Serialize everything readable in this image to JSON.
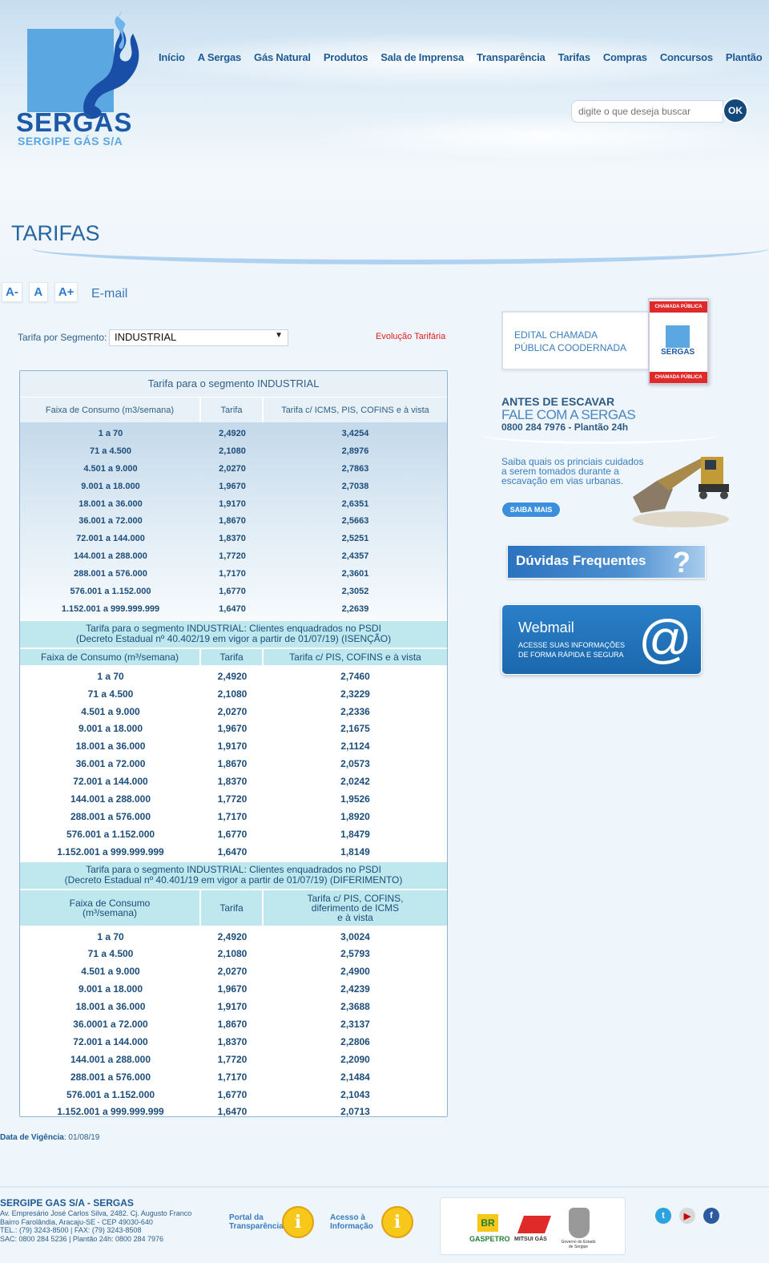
{
  "brand": {
    "name": "SERGAS",
    "subtitle": "SERGIPE GÁS S/A"
  },
  "nav": [
    "Início",
    "A Sergas",
    "Gás Natural",
    "Produtos",
    "Sala de Imprensa",
    "Transparência",
    "Tarifas",
    "Compras",
    "Concursos",
    "Plantão"
  ],
  "search": {
    "placeholder": "digite o que deseja buscar",
    "button_label": "OK"
  },
  "page_title": "TARIFAS",
  "font_controls": [
    "A-",
    "A",
    "A+"
  ],
  "email_link": "E-mail",
  "segment": {
    "label": "Tarifa por Segmento:",
    "selected": "INDUSTRIAL"
  },
  "evolution_link": "Evolução Tarifária",
  "table1": {
    "caption": "Tarifa para o segmento INDUSTRIAL",
    "headers": [
      "Faixa de Consumo (m3/semana)",
      "Tarifa",
      "Tarifa c/ ICMS, PIS, COFINS e à vista"
    ],
    "rows": [
      [
        "1 a 70",
        "2,4920",
        "3,4254"
      ],
      [
        "71 a 4.500",
        "2,1080",
        "2,8976"
      ],
      [
        "4.501 a 9.000",
        "2,0270",
        "2,7863"
      ],
      [
        "9.001 a 18.000",
        "1,9670",
        "2,7038"
      ],
      [
        "18.001 a 36.000",
        "1,9170",
        "2,6351"
      ],
      [
        "36.001 a 72.000",
        "1,8670",
        "2,5663"
      ],
      [
        "72.001 a 144.000",
        "1,8370",
        "2,5251"
      ],
      [
        "144.001 a 288.000",
        "1,7720",
        "2,4357"
      ],
      [
        "288.001 a 576.000",
        "1,7170",
        "2,3601"
      ],
      [
        "576.001 a 1.152.000",
        "1,6770",
        "2,3052"
      ],
      [
        "1.152.001 a 999.999.999",
        "1,6470",
        "2,2639"
      ]
    ]
  },
  "table2": {
    "caption_line1": "Tarifa para o segmento INDUSTRIAL: Clientes enquadrados no PSDI",
    "caption_line2": "(Decreto Estadual nº 40.402/19 em vigor a partir de 01/07/19)  (ISENÇÃO)",
    "headers": [
      "Faixa de Consumo (m³/semana)",
      "Tarifa",
      "Tarifa c/ PIS, COFINS e à vista"
    ],
    "rows": [
      [
        "1 a 70",
        "2,4920",
        "2,7460"
      ],
      [
        "71 a 4.500",
        "2,1080",
        "2,3229"
      ],
      [
        "4.501 a 9.000",
        "2,0270",
        "2,2336"
      ],
      [
        "9.001 a 18.000",
        "1,9670",
        "2,1675"
      ],
      [
        "18.001 a 36.000",
        "1,9170",
        "2,1124"
      ],
      [
        "36.001 a 72.000",
        "1,8670",
        "2,0573"
      ],
      [
        "72.001 a 144.000",
        "1,8370",
        "2,0242"
      ],
      [
        "144.001 a 288.000",
        "1,7720",
        "1,9526"
      ],
      [
        "288.001 a 576.000",
        "1,7170",
        "1,8920"
      ],
      [
        "576.001 a 1.152.000",
        "1,6770",
        "1,8479"
      ],
      [
        "1.152.001 a 999.999.999",
        "1,6470",
        "1,8149"
      ]
    ]
  },
  "table3": {
    "caption_line1": "Tarifa para o segmento INDUSTRIAL: Clientes enquadrados no PSDI",
    "caption_line2": "(Decreto Estadual nº 40.401/19 em vigor a partir de 01/07/19)  (DIFERIMENTO)",
    "header1_line1": "Faixa de Consumo",
    "header1_line2": "(m³/semana)",
    "header2": "Tarifa",
    "header3_line1": "Tarifa c/ PIS, COFINS,",
    "header3_line2": "diferimento de ICMS",
    "header3_line3": "e à vista",
    "rows": [
      [
        "1 a 70",
        "2,4920",
        "3,0024"
      ],
      [
        "71 a 4.500",
        "2,1080",
        "2,5793"
      ],
      [
        "4.501 a 9.000",
        "2,0270",
        "2,4900"
      ],
      [
        "9.001 a 18.000",
        "1,9670",
        "2,4239"
      ],
      [
        "18.001 a 36.000",
        "1,9170",
        "2,3688"
      ],
      [
        "36.0001 a 72.000",
        "1,8670",
        "2,3137"
      ],
      [
        "72.001 a 144.000",
        "1,8370",
        "2,2806"
      ],
      [
        "144.001 a 288.000",
        "1,7720",
        "2,2090"
      ],
      [
        "288.001 a 576.000",
        "1,7170",
        "2,1484"
      ],
      [
        "576.001 a 1.152.000",
        "1,6770",
        "2,1043"
      ],
      [
        "1.152.001 a 999.999.999",
        "1,6470",
        "2,0713"
      ]
    ]
  },
  "vigencia": {
    "label": "Data de Vigência",
    "value": ": 01/08/19"
  },
  "sidebar": {
    "chamada": {
      "text": "EDITAL CHAMADA PÚBLICA COODERNADA",
      "badge_top": "CHAMADA PÚBLICA",
      "badge_bottom": "CHAMADA PÚBLICA",
      "badge_brand": "SERGAS"
    },
    "escavar": {
      "line1": "ANTES DE ESCAVAR",
      "line2": "FALE COM A SERGAS",
      "line3": "0800 284 7976 - Plantão 24h",
      "body": "Saiba quais os princiais cuidados a serem tomados durante a escavação em vias urbanas.",
      "button": "SAIBA MAIS"
    },
    "duvidas": {
      "title": "Dúvidas Frequentes",
      "icon": "?"
    },
    "webmail": {
      "title": "Webmail",
      "line1": "ACESSE SUAS INFORMAÇÕES",
      "line2": "DE FORMA RÁPIDA E SEGURA",
      "icon": "@"
    }
  },
  "footer": {
    "company": "SERGIPE GAS S/A - SERGAS",
    "address_lines": [
      "Av. Empresário José Carlos Silva, 2482. Cj. Augusto Franco",
      "Bairro Farolândia, Aracaju-SE - CEP 49030-640",
      "TEL.: (79) 3243-8500 | FAX: (79) 3243-8508",
      "SAC: 0800 284 5236 | Plantão 24h: 0800 284 7976"
    ],
    "portal_line1": "Portal da",
    "portal_line2": "Transparência",
    "acesso_line1": "Acesso à",
    "acesso_line2": "Informação",
    "info_icon": "i",
    "partners": {
      "br": "BR",
      "gaspetro": "GASPETRO",
      "mitsui": "MITSUI GÁS",
      "gov_line1": "Governo do Estado",
      "gov_line2": "de Sergipe"
    },
    "social": [
      "twitter-icon",
      "youtube-icon",
      "facebook-icon"
    ]
  }
}
